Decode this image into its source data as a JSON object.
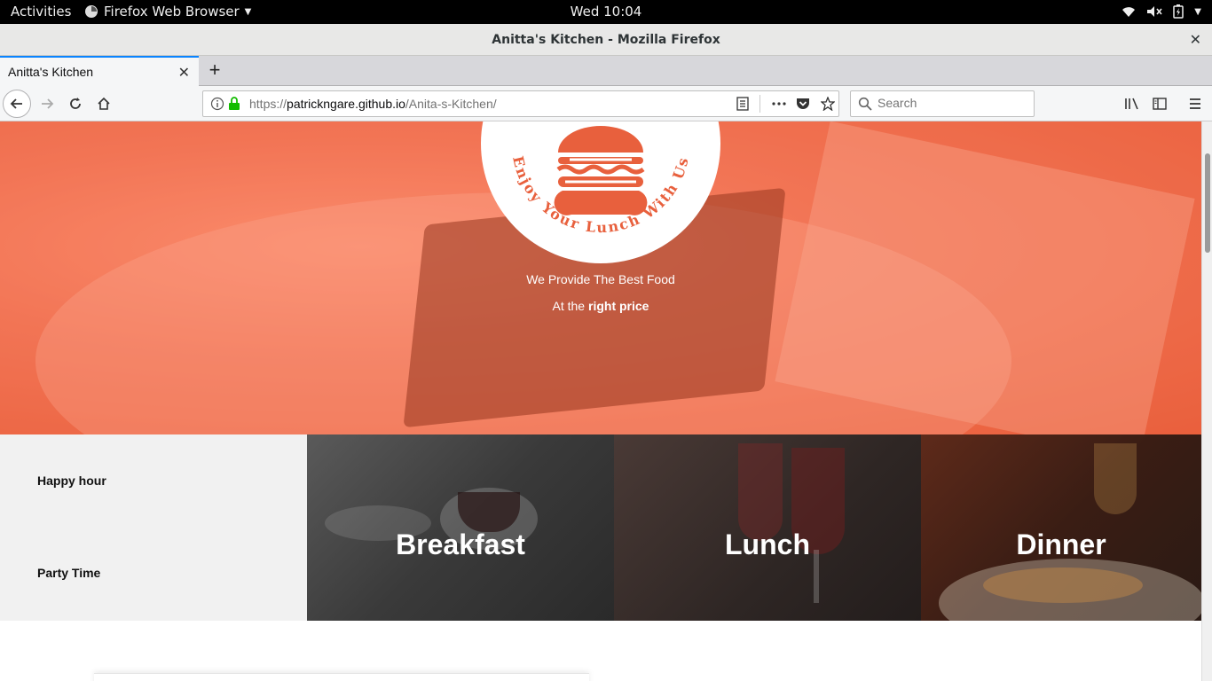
{
  "system_bar": {
    "activities": "Activities",
    "app_name": "Firefox Web Browser",
    "clock": "Wed 10:04"
  },
  "window": {
    "title": "Anitta's Kitchen - Mozilla Firefox"
  },
  "tabs": [
    {
      "label": "Anitta's Kitchen",
      "active": true
    }
  ],
  "navbar": {
    "url_prefix": "https://",
    "url_host": "patrickngare.github.io",
    "url_path": "/Anita-s-Kitchen/",
    "search_placeholder": "Search"
  },
  "hero": {
    "logo_text": "Enjoy Your Lunch With Us",
    "tagline": "We Provide The Best Food",
    "price_prefix": "At the",
    "price_emphasis": "right price"
  },
  "side_links": [
    "Happy hour",
    "Party Time"
  ],
  "meal_cards": [
    "Breakfast",
    "Lunch",
    "Dinner"
  ],
  "colors": {
    "accent": "#e8603d",
    "logo_orange": "#e8603d",
    "tab_highlight": "#0a84ff"
  }
}
